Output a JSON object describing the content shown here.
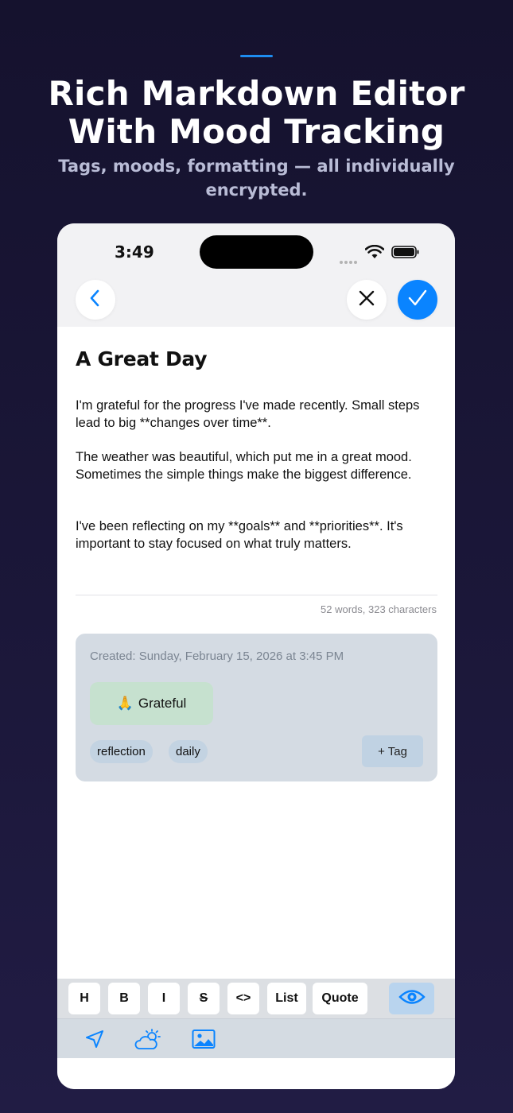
{
  "promo": {
    "headline_line1": "Rich Markdown Editor",
    "headline_line2": "With Mood Tracking",
    "subhead_line1": "Tags, moods, formatting — all individually",
    "subhead_line2": "encrypted.",
    "accent_color": "#1e8cf0"
  },
  "status_bar": {
    "time": "3:49"
  },
  "nav": {
    "back_icon": "chevron-left-icon",
    "close_icon": "close-icon",
    "done_icon": "checkmark-icon",
    "done_color": "#0a84ff"
  },
  "entry": {
    "title": "A Great Day",
    "paragraphs": [
      "I'm grateful for the progress I've made recently. Small steps lead to big **changes over time**.",
      "The weather was beautiful, which put me in a great mood. Sometimes the simple things make the biggest difference.",
      "I've been reflecting on my **goals** and **priorities**. It's important to stay focused on what truly matters."
    ],
    "counts": "52 words, 323 characters"
  },
  "meta": {
    "created": "Created: Sunday, February 15, 2026 at 3:45 PM",
    "mood_emoji": "🙏",
    "mood_label": "Grateful",
    "tags": [
      "reflection",
      "daily"
    ],
    "add_tag_label": "+ Tag"
  },
  "format_toolbar": {
    "buttons": [
      "H",
      "B",
      "I",
      "S",
      "<>",
      "List",
      "Quote"
    ],
    "preview_icon": "eye-icon"
  },
  "insert_toolbar": {
    "icons": [
      "location-arrow-icon",
      "weather-icon",
      "image-icon"
    ]
  }
}
